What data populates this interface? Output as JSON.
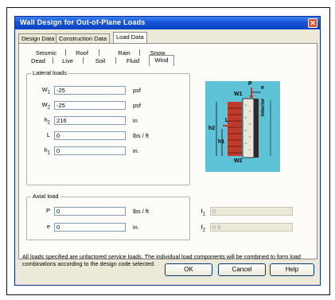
{
  "window": {
    "title": "Wall Design for Out-of-Plane Loads",
    "close_glyph": "✕"
  },
  "tabs": [
    "Design Data",
    "Construction Data",
    "Load Data"
  ],
  "subtabs": {
    "row1": [
      "Seismic",
      "Roof",
      "Rain",
      "Snow"
    ],
    "row2": [
      "Dead",
      "Live",
      "Soil",
      "Fluid",
      "Wind"
    ]
  },
  "lateral": {
    "title": "Lateral loads",
    "fields": [
      {
        "label": "W",
        "sub": "1",
        "value": "-25",
        "unit": "psf"
      },
      {
        "label": "W",
        "sub": "2",
        "value": "-25",
        "unit": "psf"
      },
      {
        "label": "h",
        "sub": "2",
        "value": "216",
        "unit": "in"
      },
      {
        "label": "L",
        "sub": "",
        "value": "0",
        "unit": "lbs / ft"
      },
      {
        "label": "h",
        "sub": "1",
        "value": "0",
        "unit": "in."
      }
    ]
  },
  "axial": {
    "title": "Axial load",
    "fields": [
      {
        "label": "P",
        "value": "0",
        "unit": "lbs / ft"
      },
      {
        "label": "e",
        "value": "0",
        "unit": "in."
      }
    ]
  },
  "side_fields": [
    {
      "label": "f",
      "sub": "1",
      "value": "0"
    },
    {
      "label": "f",
      "sub": "2",
      "value": "0.5"
    }
  ],
  "diagram": {
    "labels": {
      "p": "P",
      "e": "e",
      "w1": "W1",
      "w2": "W2",
      "h2": "h2",
      "h1": "h1",
      "l": "L",
      "interior": "Interior"
    },
    "colors": {
      "background": "#5ec3d6",
      "load": "#c0392b",
      "wall": "#e9e6dc"
    }
  },
  "note": "All loads specified are unfactored service loads. The individual load components will be combined to form load combinations according to the design code selected.",
  "buttons": {
    "ok": "OK",
    "cancel": "Cancel",
    "help": "Help"
  }
}
